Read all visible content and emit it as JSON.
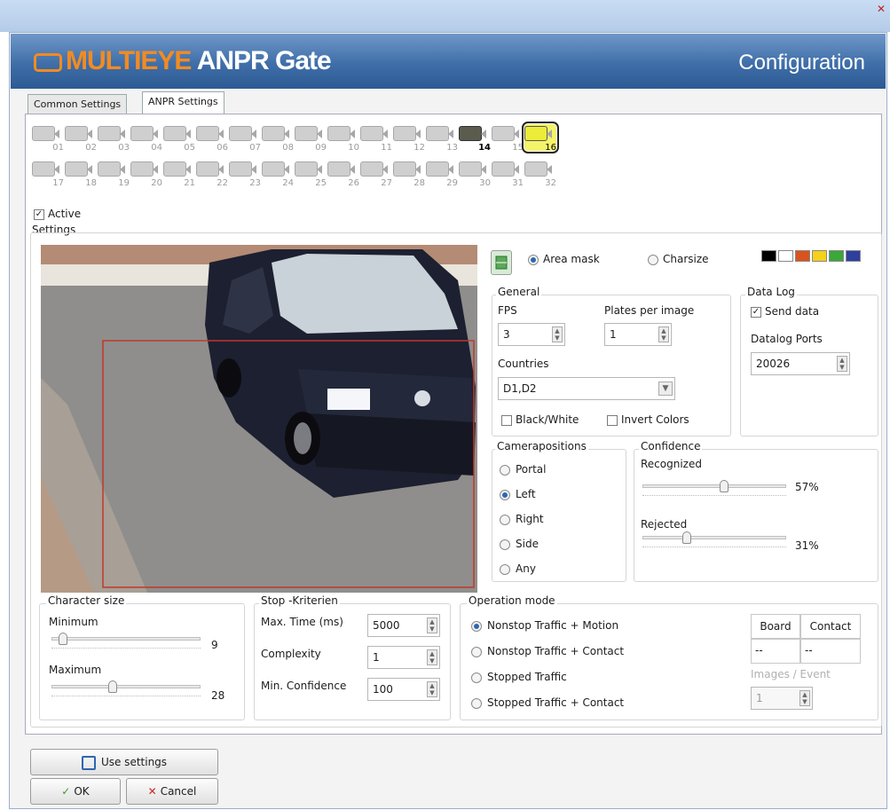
{
  "window": {
    "close_glyph": "✕",
    "brand_logo": "MULTIEYE",
    "brand_title": "ANPR Gate",
    "header_title": "Configuration",
    "accent_orange": "#f28b22",
    "header_blue": "#3f6ea8"
  },
  "tabs": [
    {
      "label": "Common Settings",
      "active": false
    },
    {
      "label": "ANPR Settings",
      "active": true
    }
  ],
  "cameras": {
    "row1": [
      "01",
      "02",
      "03",
      "04",
      "05",
      "06",
      "07",
      "08",
      "09",
      "10",
      "11",
      "12",
      "13",
      "14",
      "15",
      "16"
    ],
    "row2": [
      "17",
      "18",
      "19",
      "20",
      "21",
      "22",
      "23",
      "24",
      "25",
      "26",
      "27",
      "28",
      "29",
      "30",
      "31",
      "32"
    ],
    "active_icon_camera": "14",
    "selected_camera": "16",
    "icon": "camera-icon"
  },
  "active": {
    "label": "Active",
    "checked": true
  },
  "settings_label": "Settings",
  "mask": {
    "area_mask_label": "Area mask",
    "charsize_label": "Charsize",
    "selected": "Area mask",
    "mask_icon": "mask-tool-icon",
    "colors": [
      "#000000",
      "#ffffff",
      "#d9531e",
      "#f6d11b",
      "#3aa83a",
      "#2f3fa0"
    ]
  },
  "general": {
    "title": "General",
    "fps_label": "FPS",
    "fps_value": "3",
    "plates_label": "Plates per image",
    "plates_value": "1",
    "countries_label": "Countries",
    "countries_value": "D1,D2",
    "black_white_label": "Black/White",
    "invert_colors_label": "Invert Colors",
    "black_white_checked": false,
    "invert_colors_checked": false
  },
  "data_log": {
    "title": "Data Log",
    "send_data_label": "Send data",
    "send_data_checked": true,
    "ports_label": "Datalog Ports",
    "ports_value": "20026"
  },
  "camerapositions": {
    "title": "Camerapositions",
    "options": [
      "Portal",
      "Left",
      "Right",
      "Side",
      "Any"
    ],
    "selected": "Left"
  },
  "confidence": {
    "title": "Confidence",
    "recognized_label": "Recognized",
    "recognized_value": "57%",
    "recognized_level": 0.57,
    "rejected_label": "Rejected",
    "rejected_value": "31%",
    "rejected_level": 0.31
  },
  "character_size": {
    "title": "Character size",
    "minimum_label": "Minimum",
    "minimum_value": "9",
    "maximum_label": "Maximum",
    "maximum_value": "28"
  },
  "stop": {
    "title": "Stop -Kriterien",
    "max_time_label": "Max. Time (ms)",
    "max_time_value": "5000",
    "complexity_label": "Complexity",
    "complexity_value": "1",
    "min_confidence_label": "Min. Confidence",
    "min_confidence_value": "100"
  },
  "operation": {
    "title": "Operation mode",
    "options": [
      "Nonstop Traffic + Motion",
      "Nonstop Traffic + Contact",
      "Stopped Traffic",
      "Stopped Traffic + Contact"
    ],
    "selected": "Nonstop Traffic + Motion",
    "board_label": "Board",
    "contact_label": "Contact",
    "board_value": "--",
    "contact_value": "--",
    "images_event_label": "Images / Event",
    "images_event_value": "1"
  },
  "buttons": {
    "use_settings": "Use settings",
    "ok": "OK",
    "cancel": "Cancel"
  }
}
